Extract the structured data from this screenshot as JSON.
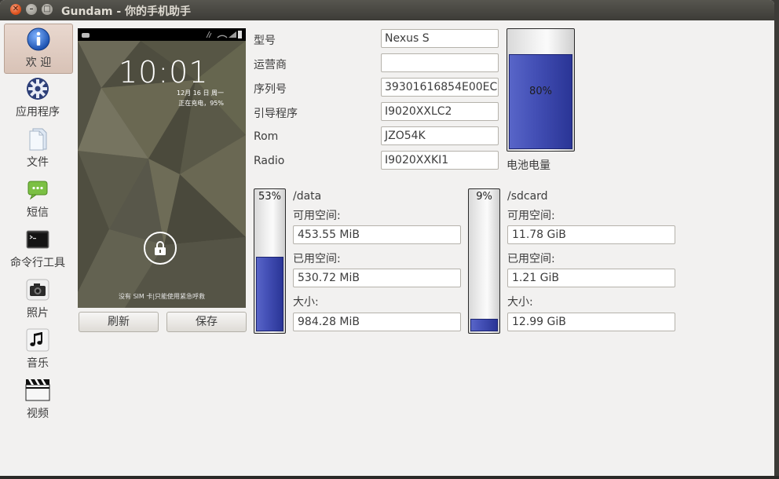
{
  "window": {
    "title": "Gundam - 你的手机助手",
    "close_icon": "close-icon",
    "minimize_icon": "minimize-icon",
    "maximize_icon": "maximize-icon"
  },
  "sidebar": {
    "items": [
      {
        "label": "欢 迎",
        "icon": "info-icon",
        "active": true
      },
      {
        "label": "应用程序",
        "icon": "gear-icon",
        "active": false
      },
      {
        "label": "文件",
        "icon": "files-icon",
        "active": false
      },
      {
        "label": "短信",
        "icon": "sms-icon",
        "active": false
      },
      {
        "label": "命令行工具",
        "icon": "terminal-icon",
        "active": false
      },
      {
        "label": "照片",
        "icon": "camera-icon",
        "active": false
      },
      {
        "label": "音乐",
        "icon": "music-icon",
        "active": false
      },
      {
        "label": "视频",
        "icon": "video-icon",
        "active": false
      }
    ]
  },
  "phone": {
    "time": "10:01",
    "date": "12月 16 日 周一",
    "charging": "正在充电，95%",
    "sim_note": "没有 SIM 卡|只能使用紧急呼救",
    "lock_icon": "lock-icon"
  },
  "buttons": {
    "refresh": "刷新",
    "save": "保存"
  },
  "info": {
    "model_label": "型号",
    "model_value": "Nexus S",
    "carrier_label": "运营商",
    "carrier_value": "",
    "serial_label": "序列号",
    "serial_value": "39301616854E00EC",
    "bootloader_label": "引导程序",
    "bootloader_value": "I9020XXLC2",
    "rom_label": "Rom",
    "rom_value": "JZO54K",
    "radio_label": "Radio",
    "radio_value": "I9020XXKI1"
  },
  "battery": {
    "percent_text": "80%",
    "level": 0.8,
    "label": "电池电量"
  },
  "storage": {
    "data": {
      "path": "/data",
      "percent_text": "53%",
      "level": 0.53,
      "free_label": "可用空间:",
      "free_value": "453.55 MiB",
      "used_label": "已用空间:",
      "used_value": "530.72 MiB",
      "size_label": "大小:",
      "size_value": "984.28 MiB"
    },
    "sdcard": {
      "path": "/sdcard",
      "percent_text": "9%",
      "level": 0.09,
      "free_label": "可用空间:",
      "free_value": "11.78 GiB",
      "used_label": "已用空间:",
      "used_value": "1.21 GiB",
      "size_label": "大小:",
      "size_value": "12.99 GiB"
    }
  },
  "colors": {
    "fill_blue": "#4450b6",
    "title_bar": "#3d3c37",
    "close_orange": "#e05420"
  }
}
